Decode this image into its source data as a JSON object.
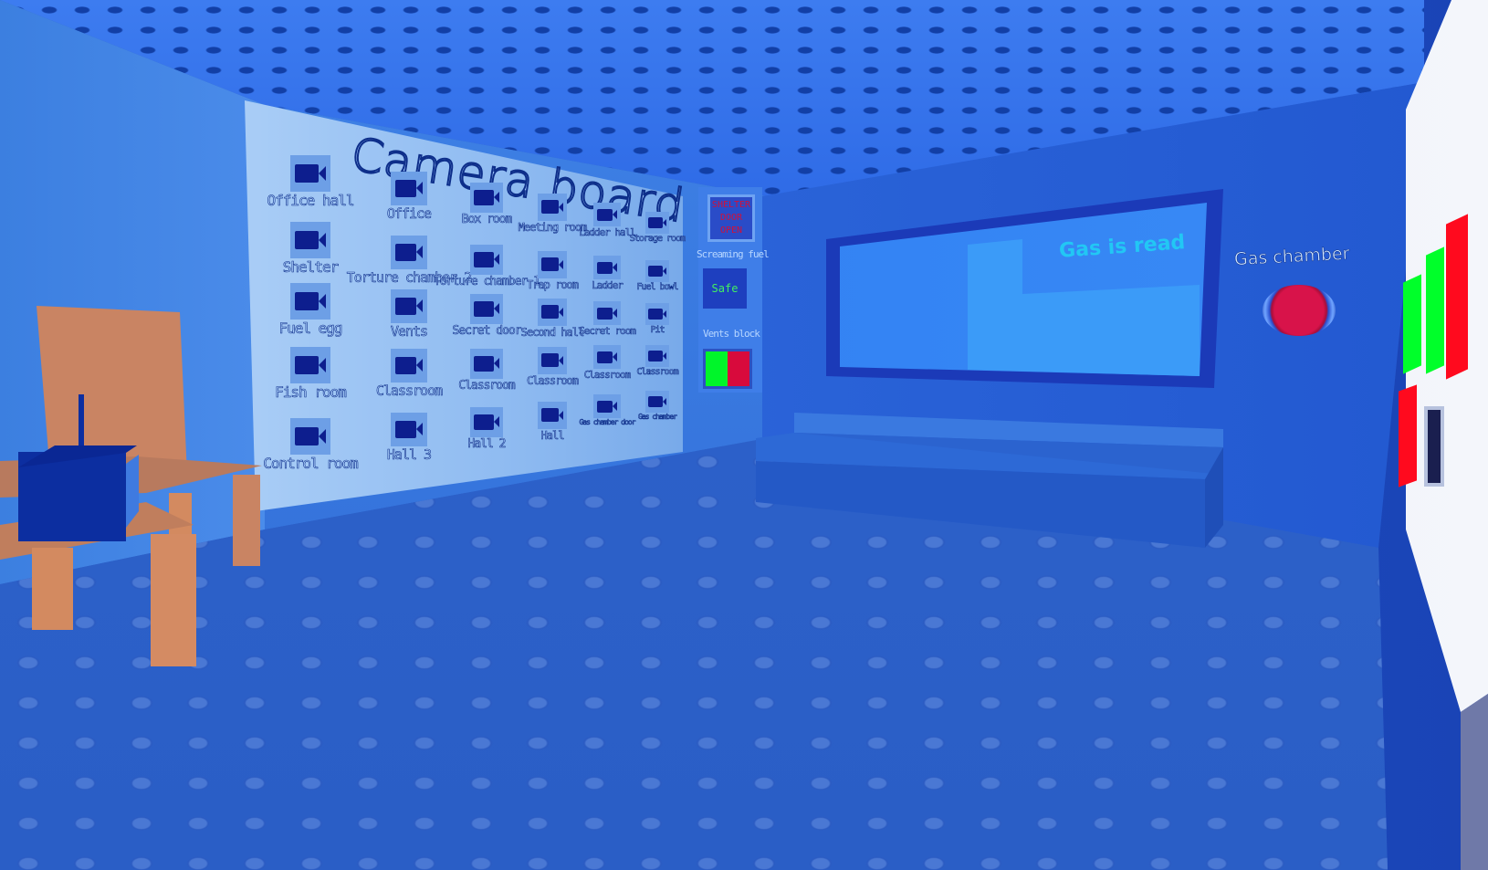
{
  "scene": {
    "type": "3D game room",
    "colors": {
      "room_blue": "#2a5fc4",
      "board_bg": "#a9cdf6",
      "camera_icon": "#0d1e8e",
      "alert_red": "#d2103a",
      "safe_green": "#42f060",
      "gas_text": "#22c7f4",
      "button_red": "#d8134a",
      "bar_green": "#00ff2a",
      "bar_red": "#ff0a1e",
      "wood": "#c98463"
    }
  },
  "camera_board": {
    "title": "Camera board",
    "cameras": [
      {
        "label": "Office hall"
      },
      {
        "label": "Office"
      },
      {
        "label": "Box room"
      },
      {
        "label": "Meeting room"
      },
      {
        "label": "Ladder hall"
      },
      {
        "label": "Storage room"
      },
      {
        "label": "Shelter"
      },
      {
        "label": "Torture chamber 2"
      },
      {
        "label": "Torture chamber 1"
      },
      {
        "label": "Trap room"
      },
      {
        "label": "Ladder"
      },
      {
        "label": "Fuel bowl"
      },
      {
        "label": "Fuel egg"
      },
      {
        "label": "Vents"
      },
      {
        "label": "Secret door"
      },
      {
        "label": "Second hall"
      },
      {
        "label": "Secret room"
      },
      {
        "label": "Pit"
      },
      {
        "label": "Fish room"
      },
      {
        "label": "Classroom"
      },
      {
        "label": "Classroom"
      },
      {
        "label": "Classroom"
      },
      {
        "label": "Classroom"
      },
      {
        "label": "Classroom"
      },
      {
        "label": "Control room"
      },
      {
        "label": "Hall 3"
      },
      {
        "label": "Hall 2"
      },
      {
        "label": "Hall"
      },
      {
        "label": "Gas chamber door"
      },
      {
        "label": "Gas chamber"
      }
    ]
  },
  "status_panel": {
    "shelter_alert": "SHELTER DOOR OPEN",
    "screaming_fuel_label": "Screaming fuel",
    "screaming_fuel_value": "Safe",
    "vents_block_label": "Vents block"
  },
  "gas_window": {
    "status_text": "Gas is read"
  },
  "gas_chamber": {
    "label": "Gas chamber"
  }
}
